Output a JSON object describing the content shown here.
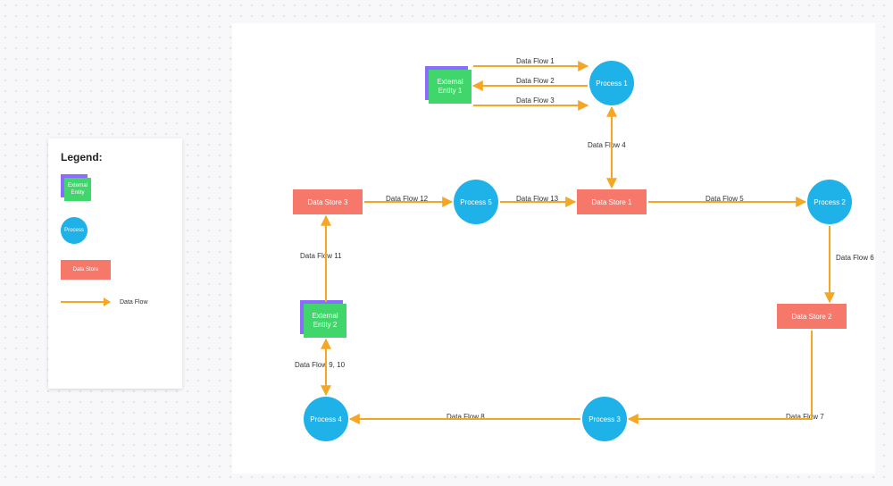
{
  "legend": {
    "title": "Legend:",
    "external_entity": "External\nEntity",
    "process": "Process",
    "data_store": "Data Store",
    "data_flow": "Data Flow"
  },
  "nodes": {
    "entity1": "External\nEntity 1",
    "entity2": "External\nEntity 2",
    "process1": "Process 1",
    "process2": "Process 2",
    "process3": "Process 3",
    "process4": "Process 4",
    "process5": "Process 5",
    "store1": "Data Store 1",
    "store2": "Data Store 2",
    "store3": "Data Store 3"
  },
  "flows": {
    "f1": "Data Flow 1",
    "f2": "Data Flow 2",
    "f3": "Data Flow 3",
    "f4": "Data Flow 4",
    "f5": "Data Flow 5",
    "f6": "Data Flow 6",
    "f7": "Data Flow 7",
    "f8": "Data Flow 8",
    "f9_10": "Data Flow 9, 10",
    "f11": "Data Flow 11",
    "f12": "Data Flow 12",
    "f13": "Data Flow 13"
  },
  "chart_data": {
    "type": "table",
    "title": "Data Flow Diagram",
    "legend": [
      "External Entity",
      "Process",
      "Data Store",
      "Data Flow"
    ],
    "entities": [
      "External Entity 1",
      "External Entity 2"
    ],
    "processes": [
      "Process 1",
      "Process 2",
      "Process 3",
      "Process 4",
      "Process 5"
    ],
    "data_stores": [
      "Data Store 1",
      "Data Store 2",
      "Data Store 3"
    ],
    "flows": [
      {
        "name": "Data Flow 1",
        "from": "External Entity 1",
        "to": "Process 1"
      },
      {
        "name": "Data Flow 2",
        "from": "Process 1",
        "to": "External Entity 1"
      },
      {
        "name": "Data Flow 3",
        "from": "External Entity 1",
        "to": "Process 1"
      },
      {
        "name": "Data Flow 4",
        "from": "Process 1",
        "to": "Data Store 1",
        "bidirectional": true
      },
      {
        "name": "Data Flow 5",
        "from": "Data Store 1",
        "to": "Process 2"
      },
      {
        "name": "Data Flow 6",
        "from": "Process 2",
        "to": "Data Store 2"
      },
      {
        "name": "Data Flow 7",
        "from": "Data Store 2",
        "to": "Process 3"
      },
      {
        "name": "Data Flow 8",
        "from": "Process 3",
        "to": "Process 4"
      },
      {
        "name": "Data Flow 9",
        "from": "Process 4",
        "to": "External Entity 2"
      },
      {
        "name": "Data Flow 10",
        "from": "External Entity 2",
        "to": "Process 4"
      },
      {
        "name": "Data Flow 11",
        "from": "External Entity 2",
        "to": "Data Store 3"
      },
      {
        "name": "Data Flow 12",
        "from": "Data Store 3",
        "to": "Process 5"
      },
      {
        "name": "Data Flow 13",
        "from": "Process 5",
        "to": "Data Store 1"
      }
    ]
  }
}
